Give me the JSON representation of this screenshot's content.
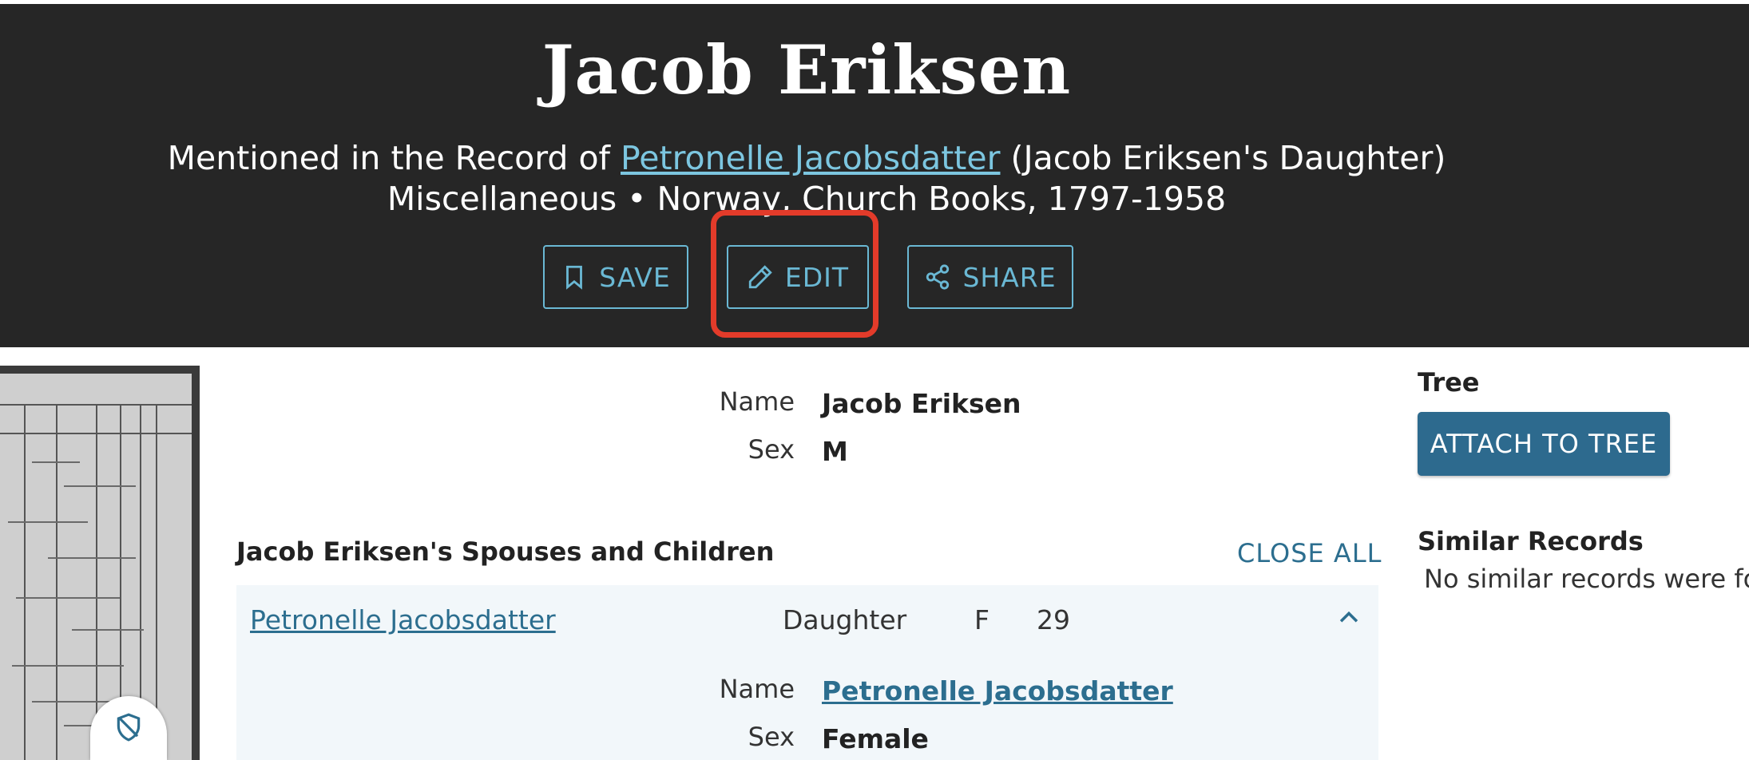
{
  "header": {
    "title": "Jacob Eriksen",
    "mentioned_prefix": "Mentioned in the Record of ",
    "mentioned_link": "Petronelle Jacobsdatter",
    "mentioned_suffix": " (Jacob Eriksen's Daughter)",
    "collection": "Miscellaneous • Norway, Church Books, 1797-1958",
    "save_label": "SAVE",
    "edit_label": "EDIT",
    "share_label": "SHARE",
    "accent_color": "#6ab8d4",
    "highlight_color": "#e33b2a"
  },
  "person": {
    "name_label": "Name",
    "name_value": "Jacob Eriksen",
    "sex_label": "Sex",
    "sex_value": "M"
  },
  "family": {
    "section_title": "Jacob Eriksen's Spouses and Children",
    "close_all_label": "CLOSE ALL",
    "members": [
      {
        "name": "Petronelle Jacobsdatter",
        "relationship": "Daughter",
        "sex": "F",
        "age": "29",
        "details": {
          "name_label": "Name",
          "name_value": "Petronelle Jacobsdatter",
          "sex_label": "Sex",
          "sex_value": "Female"
        }
      }
    ]
  },
  "sidebar": {
    "tree_title": "Tree",
    "attach_label": "ATTACH TO TREE",
    "similar_title": "Similar Records",
    "similar_text": "No similar records were fou"
  },
  "icons": {
    "save": "bookmark-icon",
    "edit": "pencil-icon",
    "share": "share-icon",
    "shield": "shield-off-icon",
    "chevron": "chevron-up-icon"
  }
}
